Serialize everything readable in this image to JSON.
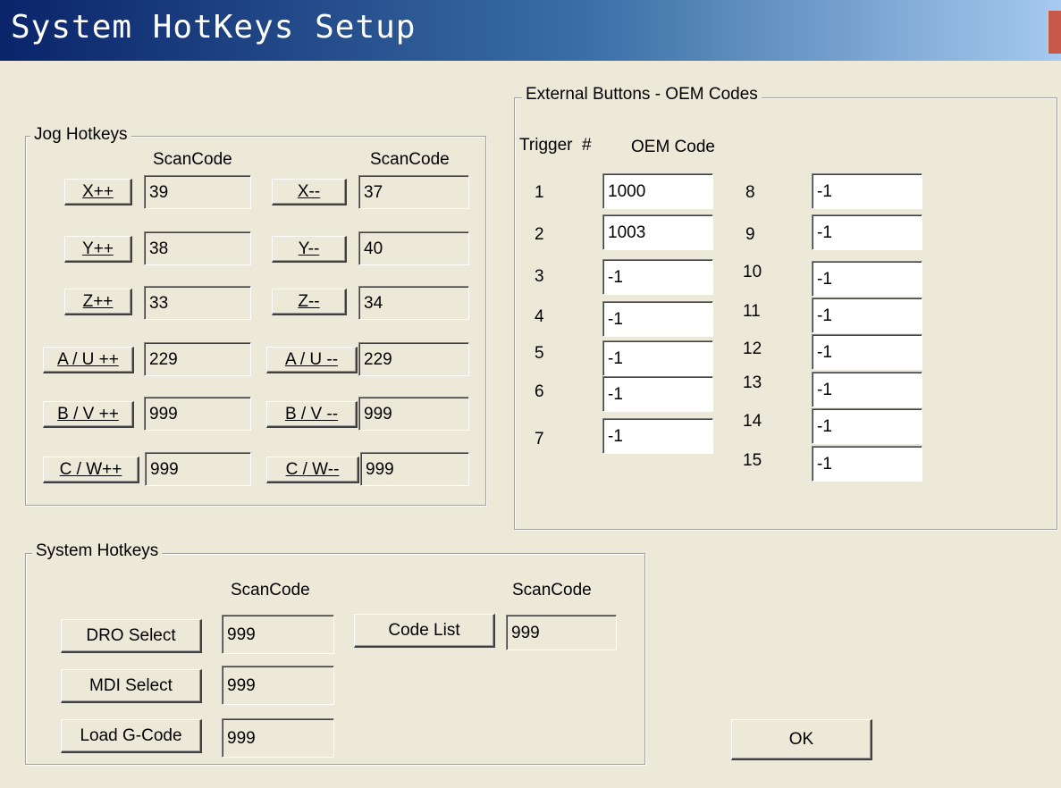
{
  "window": {
    "title": "System HotKeys Setup"
  },
  "jog": {
    "legend": "Jog Hotkeys",
    "col1_header": "ScanCode",
    "col2_header": "ScanCode",
    "rows": [
      {
        "plus_label": "X++",
        "plus_code": "39",
        "minus_label": "X--",
        "minus_code": "37"
      },
      {
        "plus_label": "Y++",
        "plus_code": "38",
        "minus_label": "Y--",
        "minus_code": "40"
      },
      {
        "plus_label": "Z++",
        "plus_code": "33",
        "minus_label": "Z--",
        "minus_code": "34"
      },
      {
        "plus_label": "A / U ++",
        "plus_code": "229",
        "minus_label": "A / U --",
        "minus_code": "229"
      },
      {
        "plus_label": "B / V ++",
        "plus_code": "999",
        "minus_label": "B / V --",
        "minus_code": "999"
      },
      {
        "plus_label": "C / W++",
        "plus_code": "999",
        "minus_label": "C / W--",
        "minus_code": "999"
      }
    ]
  },
  "external": {
    "legend": "External Buttons - OEM Codes",
    "trigger_header": "Trigger  #",
    "oem_header": "OEM Code",
    "left": [
      {
        "num": "1",
        "code": "1000"
      },
      {
        "num": "2",
        "code": "1003"
      },
      {
        "num": "3",
        "code": "-1"
      },
      {
        "num": "4",
        "code": "-1"
      },
      {
        "num": "5",
        "code": "-1"
      },
      {
        "num": "6",
        "code": "-1"
      },
      {
        "num": "7",
        "code": "-1"
      }
    ],
    "right": [
      {
        "num": "8",
        "code": "-1"
      },
      {
        "num": "9",
        "code": "-1"
      },
      {
        "num": "10",
        "code": "-1"
      },
      {
        "num": "11",
        "code": "-1"
      },
      {
        "num": "12",
        "code": "-1"
      },
      {
        "num": "13",
        "code": "-1"
      },
      {
        "num": "14",
        "code": "-1"
      },
      {
        "num": "15",
        "code": "-1"
      }
    ]
  },
  "system": {
    "legend": "System Hotkeys",
    "col1_header": "ScanCode",
    "col2_header": "ScanCode",
    "dro_label": "DRO Select",
    "dro_code": "999",
    "mdi_label": "MDI Select",
    "mdi_code": "999",
    "load_label": "Load G-Code",
    "load_code": "999",
    "codelist_label": "Code List",
    "codelist_code": "999"
  },
  "ok_label": "OK",
  "colors": {
    "dialog_bg": "#ece9d8",
    "titlebar_start": "#0a246a",
    "titlebar_end": "#a6caf0"
  }
}
